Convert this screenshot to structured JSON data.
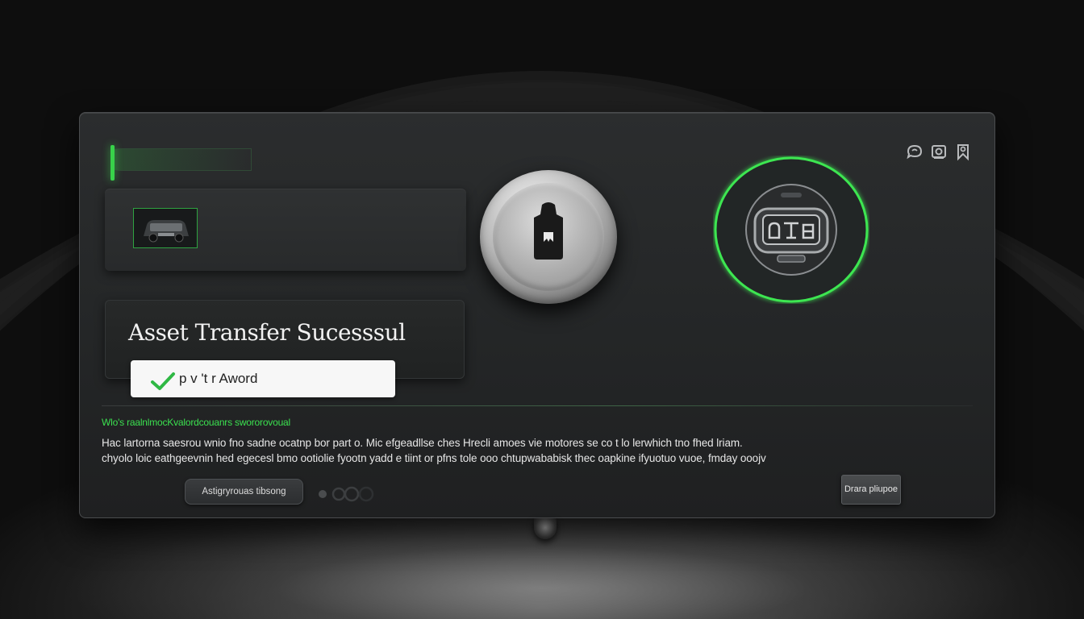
{
  "header": {
    "icons": [
      "chat-icon",
      "camera-icon",
      "bookmark-icon"
    ]
  },
  "main": {
    "title": "Asset Transfer Sucesssul",
    "award_text": "p v 't r Aword",
    "lock_icon": "lock-icon",
    "ring_icon": "device-icon"
  },
  "details": {
    "link_text": "Wlo's raalnlmocKvalordcouanrs swororovoual",
    "body_line_1": "Hac lartorna saesrou wnio fno sadne ocatnp bor part o. Mic efgeadllse ches Hrecli amoes vie motores se co t lo lerwhich tno fhed lriam.",
    "body_line_2": "chyolo loic eathgeevnin hed egecesl bmo ootiolie fyootn yadd e tiint or pfns tole ooo chtupwababisk thec oapkine ifyuotuo vuoe, fmday ooojv"
  },
  "actions": {
    "left_button": "Astigryrouas tibsong",
    "right_button": "Drara pliupoe"
  },
  "colors": {
    "accent": "#38d24a",
    "panel": "#262829"
  }
}
